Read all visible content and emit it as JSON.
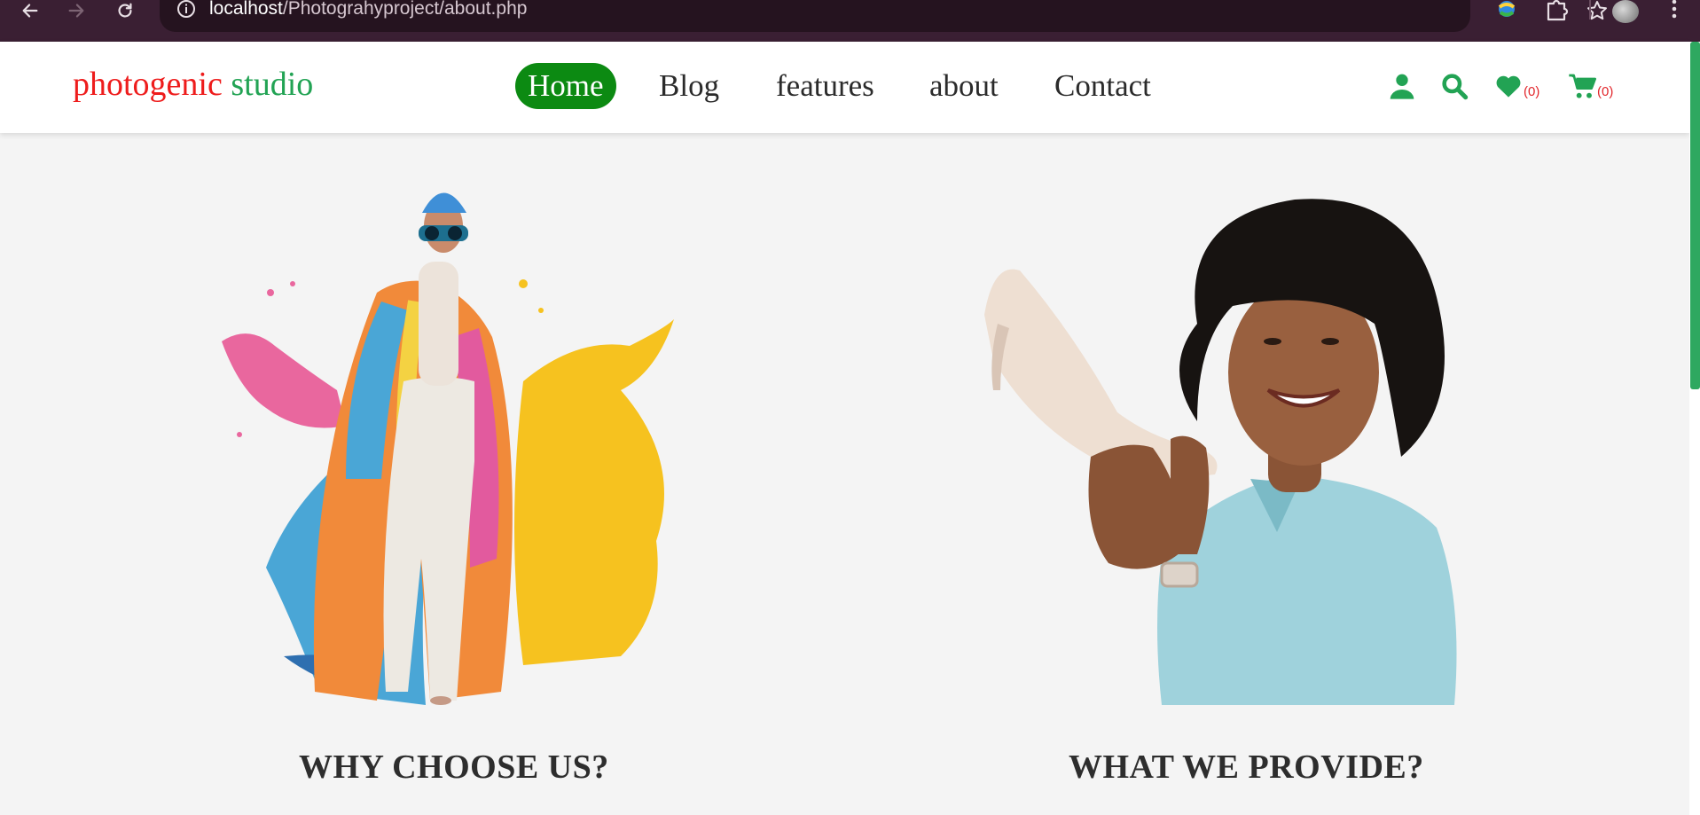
{
  "browser": {
    "url_host": "localhost",
    "url_path": "/Photograhyproject/about.php",
    "icons": [
      "back-arrow-icon",
      "forward-arrow-icon",
      "reload-icon",
      "site-info-icon",
      "bookmark-star-icon",
      "extension-icon",
      "puzzle-icon",
      "profile-avatar",
      "more-menu-icon"
    ]
  },
  "header": {
    "logo_part1": "photogenic",
    "logo_part2": "studio",
    "nav": [
      {
        "label": "Home",
        "active": true
      },
      {
        "label": "Blog",
        "active": false
      },
      {
        "label": "features",
        "active": false
      },
      {
        "label": "about",
        "active": false
      },
      {
        "label": "Contact",
        "active": false
      }
    ],
    "wishlist_count": "(0)",
    "cart_count": "(0)",
    "icons": [
      "user-icon",
      "search-icon",
      "heart-icon",
      "cart-icon"
    ]
  },
  "sections": [
    {
      "title": "WHY CHOOSE US?",
      "image": "fashion-model-paint-splash-photo"
    },
    {
      "title": "WHAT WE PROVIDE?",
      "image": "woman-holding-heel-shoe-photo"
    }
  ],
  "colors": {
    "accent": "#22a354",
    "logo_red": "#ee1c1c",
    "nav_active": "#0c8a12",
    "browser_bar": "#3a1f33",
    "page_bg": "#f4f4f4",
    "count_red": "#e2262b"
  }
}
